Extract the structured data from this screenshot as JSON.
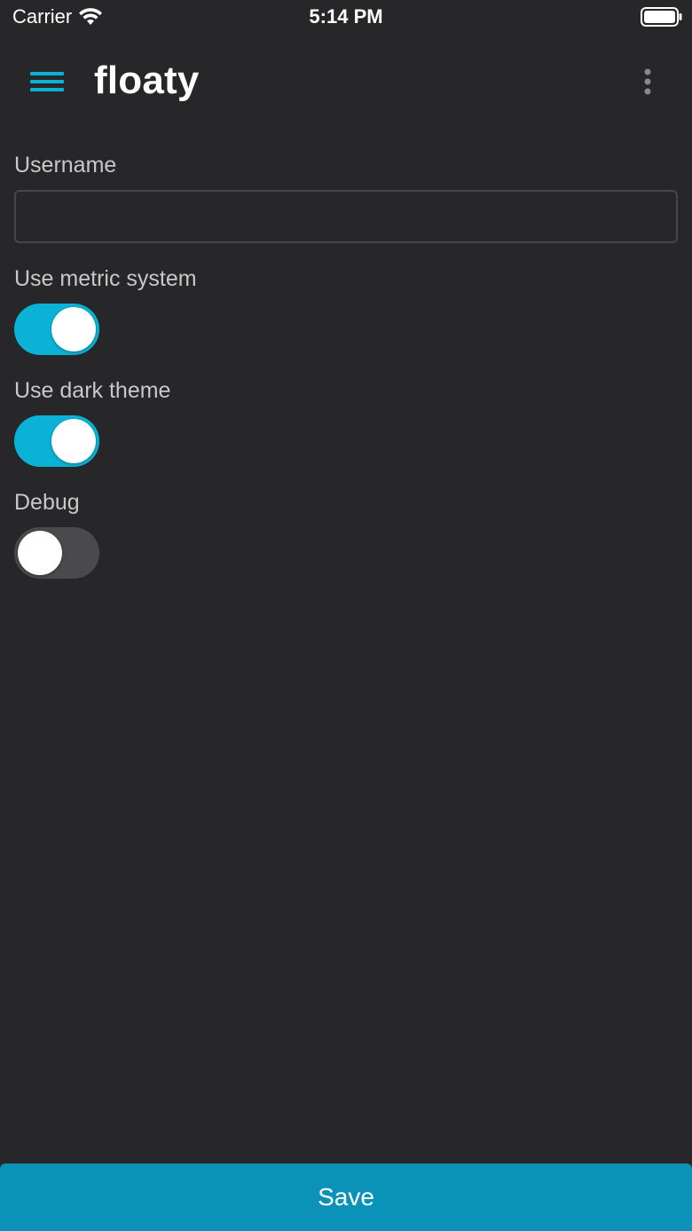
{
  "status_bar": {
    "carrier": "Carrier",
    "time": "5:14 PM",
    "wifi_icon": "wifi-icon",
    "battery_icon": "battery-icon"
  },
  "app_bar": {
    "title": "floaty",
    "menu_icon": "hamburger-menu-icon",
    "more_icon": "more-vertical-icon"
  },
  "form": {
    "username": {
      "label": "Username",
      "value": "",
      "placeholder": ""
    },
    "metric": {
      "label": "Use metric system",
      "on": true
    },
    "dark_theme": {
      "label": "Use dark theme",
      "on": true
    },
    "debug": {
      "label": "Debug",
      "on": false
    }
  },
  "save_button": {
    "label": "Save"
  },
  "colors": {
    "background": "#27272a",
    "accent": "#0ab3d6",
    "save_button": "#0a92b8"
  }
}
